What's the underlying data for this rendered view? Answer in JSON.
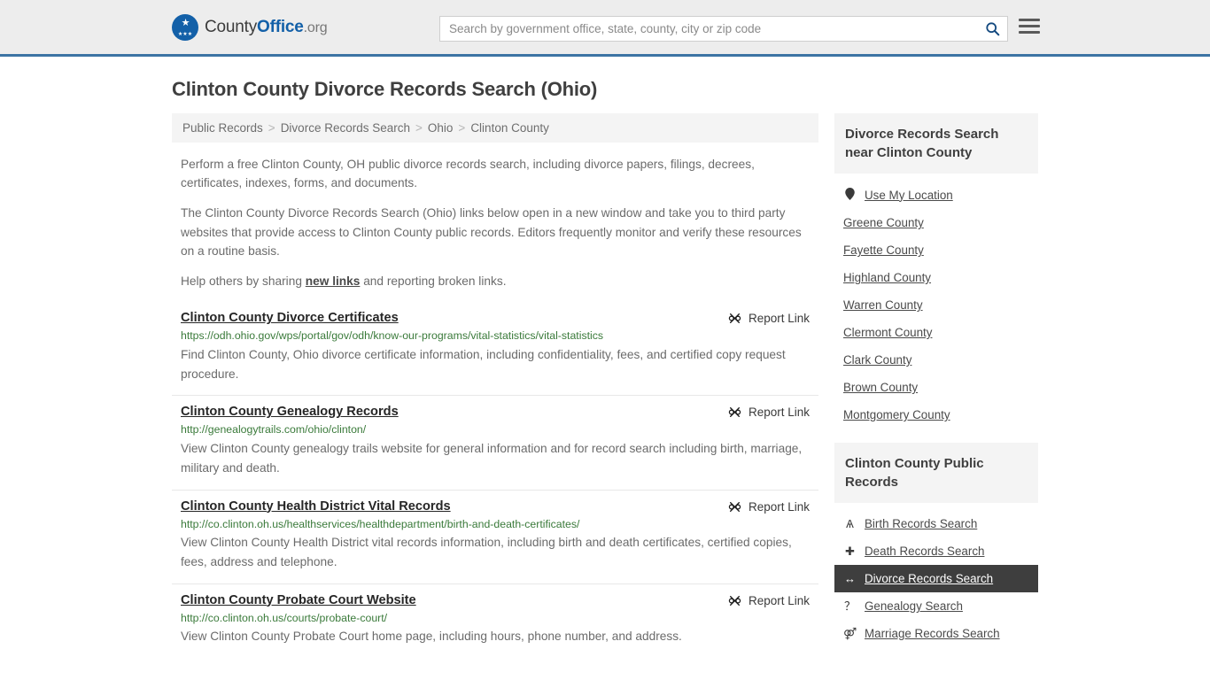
{
  "header": {
    "logo": {
      "part1": "County",
      "part2": "Office",
      "part3": ".org",
      "mark_icon": "eagle-shield-icon"
    },
    "search": {
      "placeholder": "Search by government office, state, county, city or zip code",
      "value": "",
      "icon": "search-icon"
    },
    "menu_icon": "hamburger-menu-icon"
  },
  "page": {
    "title": "Clinton County Divorce Records Search (Ohio)"
  },
  "breadcrumb": {
    "separator": ">",
    "items": [
      {
        "label": "Public Records"
      },
      {
        "label": "Divorce Records Search"
      },
      {
        "label": "Ohio"
      },
      {
        "label": "Clinton County"
      }
    ]
  },
  "intro": {
    "p1": "Perform a free Clinton County, OH public divorce records search, including divorce papers, filings, decrees, certificates, indexes, forms, and documents.",
    "p2": "The Clinton County Divorce Records Search (Ohio) links below open in a new window and take you to third party websites that provide access to Clinton County public records. Editors frequently monitor and verify these resources on a routine basis.",
    "p3_before": "Help others by sharing ",
    "p3_link": "new links",
    "p3_after": " and reporting broken links."
  },
  "report_link": {
    "label": "Report Link",
    "icon": "broken-link-icon"
  },
  "results": [
    {
      "title": "Clinton County Divorce Certificates",
      "url": "https://odh.ohio.gov/wps/portal/gov/odh/know-our-programs/vital-statistics/vital-statistics",
      "description": "Find Clinton County, Ohio divorce certificate information, including confidentiality, fees, and certified copy request procedure."
    },
    {
      "title": "Clinton County Genealogy Records",
      "url": "http://genealogytrails.com/ohio/clinton/",
      "description": "View Clinton County genealogy trails website for general information and for record search including birth, marriage, military and death."
    },
    {
      "title": "Clinton County Health District Vital Records",
      "url": "http://co.clinton.oh.us/healthservices/healthdepartment/birth-and-death-certificates/",
      "description": "View Clinton County Health District vital records information, including birth and death certificates, certified copies, fees, address and telephone."
    },
    {
      "title": "Clinton County Probate Court Website",
      "url": "http://co.clinton.oh.us/courts/probate-court/",
      "description": "View Clinton County Probate Court home page, including hours, phone number, and address."
    }
  ],
  "sidebar": {
    "nearby": {
      "title": "Divorce Records Search near Clinton County",
      "items": [
        {
          "label": "Use My Location",
          "icon": "map-pin-icon",
          "active": false
        },
        {
          "label": "Greene County",
          "icon": "",
          "active": false
        },
        {
          "label": "Fayette County",
          "icon": "",
          "active": false
        },
        {
          "label": "Highland County",
          "icon": "",
          "active": false
        },
        {
          "label": "Warren County",
          "icon": "",
          "active": false
        },
        {
          "label": "Clermont County",
          "icon": "",
          "active": false
        },
        {
          "label": "Clark County",
          "icon": "",
          "active": false
        },
        {
          "label": "Brown County",
          "icon": "",
          "active": false
        },
        {
          "label": "Montgomery County",
          "icon": "",
          "active": false
        }
      ]
    },
    "public_records": {
      "title": "Clinton County Public Records",
      "items": [
        {
          "label": "Birth Records Search",
          "icon": "baby-icon",
          "glyph": "Ѧ",
          "active": false
        },
        {
          "label": "Death Records Search",
          "icon": "cross-icon",
          "glyph": "✚",
          "active": false
        },
        {
          "label": "Divorce Records Search",
          "icon": "left-right-arrow-icon",
          "glyph": "↔",
          "active": true
        },
        {
          "label": "Genealogy Search",
          "icon": "question-mark-icon",
          "glyph": "？",
          "active": false
        },
        {
          "label": "Marriage Records Search",
          "icon": "male-female-icon",
          "glyph": "⚤",
          "active": false
        }
      ]
    }
  },
  "colors": {
    "brand_blue": "#1360a8",
    "header_bg": "#ededed",
    "header_border": "#3c74a4",
    "url_green": "#3a7a3a",
    "active_bg": "#3e3e3e",
    "panel_bg": "#f4f4f4"
  }
}
